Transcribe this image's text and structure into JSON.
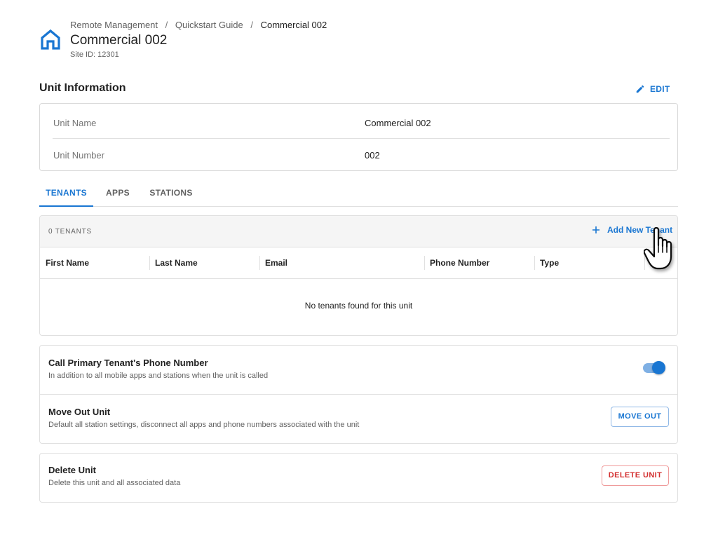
{
  "header": {
    "breadcrumb": [
      "Remote Management",
      "Quickstart Guide",
      "Commercial 002"
    ],
    "breadcrumb_separator": "/",
    "site_name": "Commercial 002",
    "site_id": "Site ID: 12301",
    "icon": "home-icon"
  },
  "unit_info": {
    "title": "Unit Information",
    "edit_label": "EDIT",
    "rows": [
      {
        "label": "Unit Name",
        "value": "Commercial 002"
      },
      {
        "label": "Unit Number",
        "value": "002"
      }
    ]
  },
  "tabs": [
    {
      "label": "TENANTS",
      "active": true
    },
    {
      "label": "APPS",
      "active": false
    },
    {
      "label": "STATIONS",
      "active": false
    }
  ],
  "tenants": {
    "count_label": "0 TENANTS",
    "add_label": "Add New Tenant",
    "columns": [
      "First Name",
      "Last Name",
      "Email",
      "Phone Number",
      "Type"
    ],
    "empty_message": "No tenants found for this unit"
  },
  "settings": {
    "call_primary": {
      "title": "Call Primary Tenant's Phone Number",
      "description": "In addition to all mobile apps and stations when the unit is called",
      "enabled": true
    },
    "move_out": {
      "title": "Move Out Unit",
      "description": "Default all station settings, disconnect all apps and phone numbers associated with the unit",
      "button_label": "MOVE OUT"
    }
  },
  "delete": {
    "title": "Delete Unit",
    "description": "Delete this unit and all associated data",
    "button_label": "DELETE UNIT"
  },
  "colors": {
    "accent": "#1976d2",
    "danger": "#d32f2f"
  }
}
